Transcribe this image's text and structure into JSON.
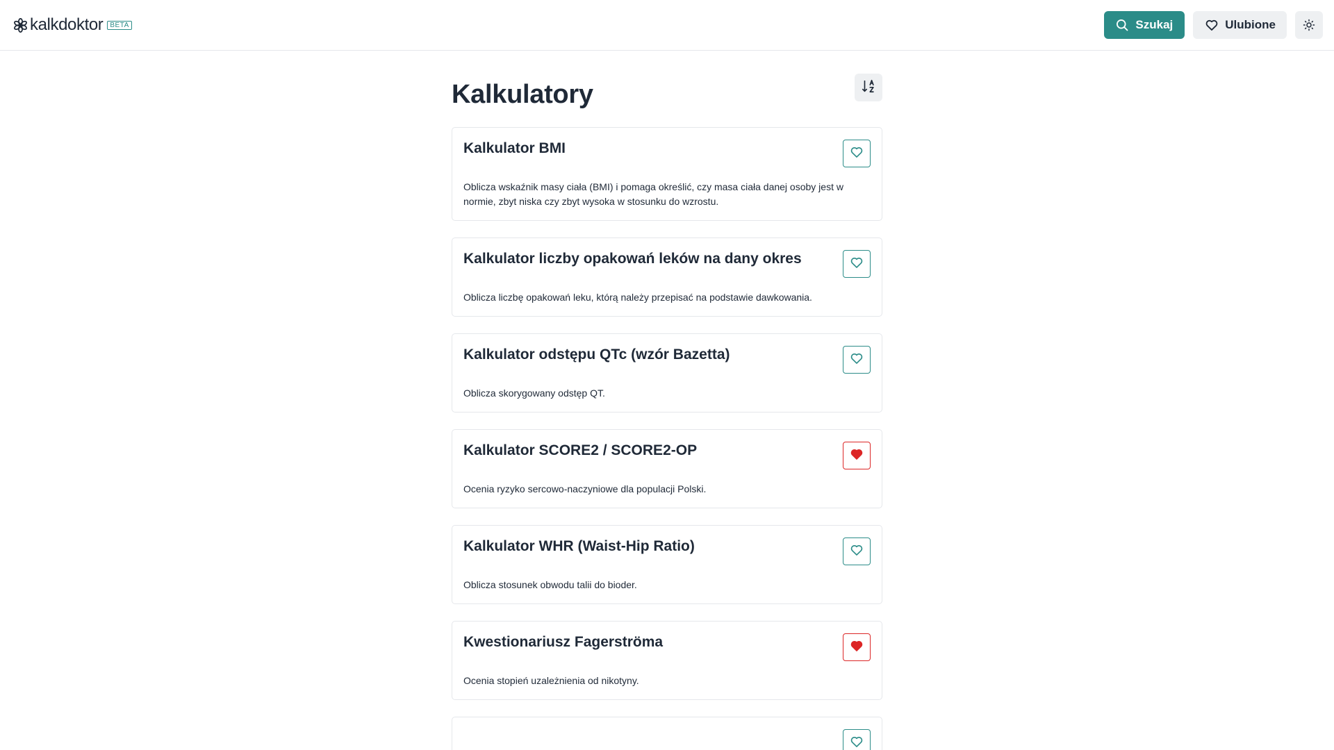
{
  "header": {
    "logo_text": "kalkdoktor",
    "beta_label": "BETA",
    "search_label": "Szukaj",
    "favorites_label": "Ulubione",
    "theme_icon": "sun-icon"
  },
  "main": {
    "title": "Kalkulatory",
    "sort_icon": "sort-alpha-icon"
  },
  "colors": {
    "accent": "#2b8c88",
    "favorite_active": "#dc2626",
    "text": "#1f2937",
    "border": "#e5e7eb",
    "button_bg": "#eef0f2"
  },
  "calculators": [
    {
      "title": "Kalkulator BMI",
      "description": "Oblicza wskaźnik masy ciała (BMI) i pomaga określić, czy masa ciała danej osoby jest w normie, zbyt niska czy zbyt wysoka w stosunku do wzrostu.",
      "favorite": false
    },
    {
      "title": "Kalkulator liczby opakowań leków na dany okres",
      "description": "Oblicza liczbę opakowań leku, którą należy przepisać na podstawie dawkowania.",
      "favorite": false
    },
    {
      "title": "Kalkulator odstępu QTc (wzór Bazetta)",
      "description": "Oblicza skorygowany odstęp QT.",
      "favorite": false
    },
    {
      "title": "Kalkulator SCORE2 / SCORE2-OP",
      "description": "Ocenia ryzyko sercowo-naczyniowe dla populacji Polski.",
      "favorite": true
    },
    {
      "title": "Kalkulator WHR (Waist-Hip Ratio)",
      "description": "Oblicza stosunek obwodu talii do bioder.",
      "favorite": false
    },
    {
      "title": "Kwestionariusz Fagerströma",
      "description": "Ocenia stopień uzależnienia od nikotyny.",
      "favorite": true
    },
    {
      "title": "",
      "description": "",
      "favorite": false
    }
  ]
}
